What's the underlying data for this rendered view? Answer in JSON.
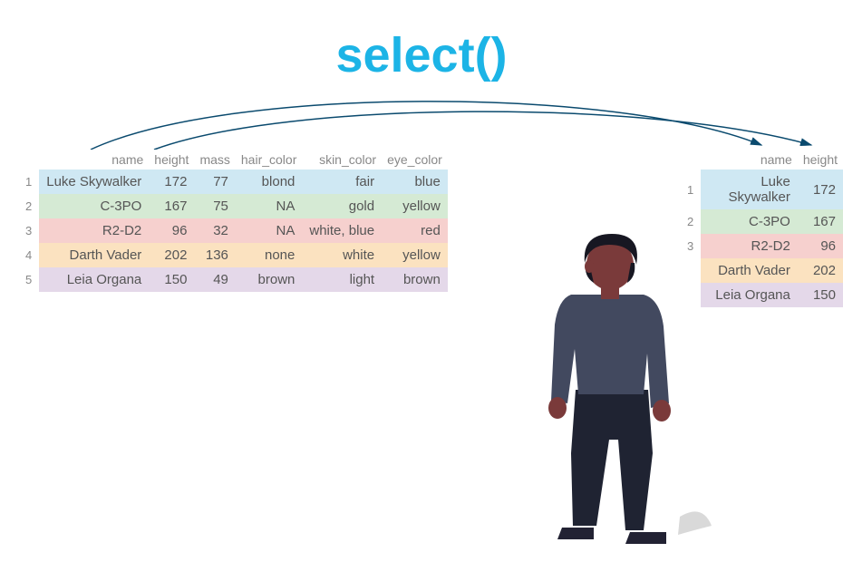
{
  "title": "select()",
  "left": {
    "headers": [
      "name",
      "height",
      "mass",
      "hair_color",
      "skin_color",
      "eye_color"
    ],
    "rows": [
      {
        "idx": "1",
        "name": "Luke Skywalker",
        "height": "172",
        "mass": "77",
        "hair_color": "blond",
        "skin_color": "fair",
        "eye_color": "blue",
        "cls": "r-blue"
      },
      {
        "idx": "2",
        "name": "C-3PO",
        "height": "167",
        "mass": "75",
        "hair_color": "NA",
        "skin_color": "gold",
        "eye_color": "yellow",
        "cls": "r-green"
      },
      {
        "idx": "3",
        "name": "R2-D2",
        "height": "96",
        "mass": "32",
        "hair_color": "NA",
        "skin_color": "white, blue",
        "eye_color": "red",
        "cls": "r-red"
      },
      {
        "idx": "4",
        "name": "Darth Vader",
        "height": "202",
        "mass": "136",
        "hair_color": "none",
        "skin_color": "white",
        "eye_color": "yellow",
        "cls": "r-yellow"
      },
      {
        "idx": "5",
        "name": "Leia Organa",
        "height": "150",
        "mass": "49",
        "hair_color": "brown",
        "skin_color": "light",
        "eye_color": "brown",
        "cls": "r-purple"
      }
    ]
  },
  "right": {
    "headers": [
      "name",
      "height"
    ],
    "rows": [
      {
        "idx": "1",
        "name": "Luke Skywalker",
        "height": "172",
        "cls": "r-blue"
      },
      {
        "idx": "2",
        "name": "C-3PO",
        "height": "167",
        "cls": "r-green"
      },
      {
        "idx": "3",
        "name": "R2-D2",
        "height": "96",
        "cls": "r-red"
      },
      {
        "idx": "",
        "name": "Darth Vader",
        "height": "202",
        "cls": "r-yellow"
      },
      {
        "idx": "",
        "name": "Leia Organa",
        "height": "150",
        "cls": "r-purple"
      }
    ]
  },
  "chart_data": {
    "type": "table",
    "columns_source": [
      "name",
      "height",
      "mass",
      "hair_color",
      "skin_color",
      "eye_color"
    ],
    "rows_source": [
      [
        "Luke Skywalker",
        172,
        77,
        "blond",
        "fair",
        "blue"
      ],
      [
        "C-3PO",
        167,
        75,
        "NA",
        "gold",
        "yellow"
      ],
      [
        "R2-D2",
        96,
        32,
        "NA",
        "white, blue",
        "red"
      ],
      [
        "Darth Vader",
        202,
        136,
        "none",
        "white",
        "yellow"
      ],
      [
        "Leia Organa",
        150,
        49,
        "brown",
        "light",
        "brown"
      ]
    ],
    "columns_selected": [
      "name",
      "height"
    ],
    "rows_selected": [
      [
        "Luke Skywalker",
        172
      ],
      [
        "C-3PO",
        167
      ],
      [
        "R2-D2",
        96
      ],
      [
        "Darth Vader",
        202
      ],
      [
        "Leia Organa",
        150
      ]
    ],
    "operation": "select(name, height)"
  }
}
